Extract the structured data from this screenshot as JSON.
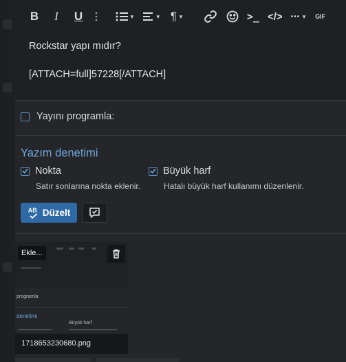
{
  "toolbar": {
    "bold_label": "B",
    "italic_label": "I",
    "underline_label": "U",
    "paragraph_label": "¶",
    "code_label": ">_",
    "html_label": "</>",
    "more_label": "•••",
    "gif_label": "GIF"
  },
  "editor": {
    "line1": "Rockstar yapı mıdır?",
    "line2": "[ATTACH=full]57228[/ATTACH]"
  },
  "schedule": {
    "label": "Yayını programla:",
    "checked": false
  },
  "spellcheck": {
    "title": "Yazım denetimi",
    "options": [
      {
        "label": "Nokta",
        "description": "Satır sonlarına nokta eklenir.",
        "checked": true
      },
      {
        "label": "Büyük harf",
        "description": "Hatalı büyük harf kullanımı düzenlenir.",
        "checked": true
      }
    ],
    "fix_button": "Düzelt",
    "fix_icon_text": "AB"
  },
  "attachment": {
    "badge": "Ekle...",
    "filename": "1718653230680.png",
    "thumb_text_1": "programla",
    "thumb_text_2": "denetimi",
    "thumb_text_3": "Büyük harf"
  },
  "colors": {
    "accent": "#2f6aa6",
    "link": "#6ea6db",
    "background": "#252629"
  }
}
